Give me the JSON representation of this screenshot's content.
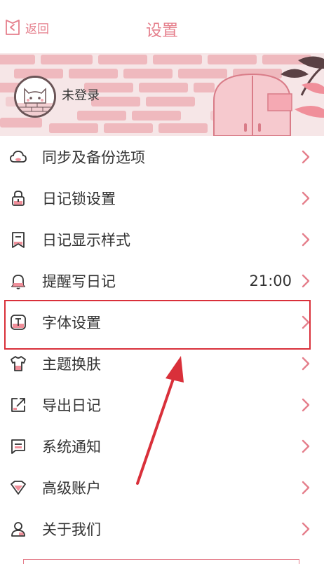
{
  "header": {
    "back_label": "返回",
    "title": "设置"
  },
  "profile": {
    "name": "未登录"
  },
  "menu": {
    "items": [
      {
        "label": "同步及备份选项",
        "value": "",
        "icon": "cloud-icon"
      },
      {
        "label": "日记锁设置",
        "value": "",
        "icon": "lock-icon"
      },
      {
        "label": "日记显示样式",
        "value": "",
        "icon": "bookmark-icon"
      },
      {
        "label": "提醒写日记",
        "value": "21:00",
        "icon": "bell-icon"
      },
      {
        "label": "字体设置",
        "value": "",
        "icon": "font-icon"
      },
      {
        "label": "主题换肤",
        "value": "",
        "icon": "shirt-icon"
      },
      {
        "label": "导出日记",
        "value": "",
        "icon": "export-icon"
      },
      {
        "label": "系统通知",
        "value": "",
        "icon": "message-icon"
      },
      {
        "label": "高级账户",
        "value": "",
        "icon": "diamond-icon"
      },
      {
        "label": "关于我们",
        "value": "",
        "icon": "user-icon"
      }
    ]
  },
  "colors": {
    "accent": "#e57f8c",
    "highlight": "#d9303a",
    "text": "#333333"
  }
}
